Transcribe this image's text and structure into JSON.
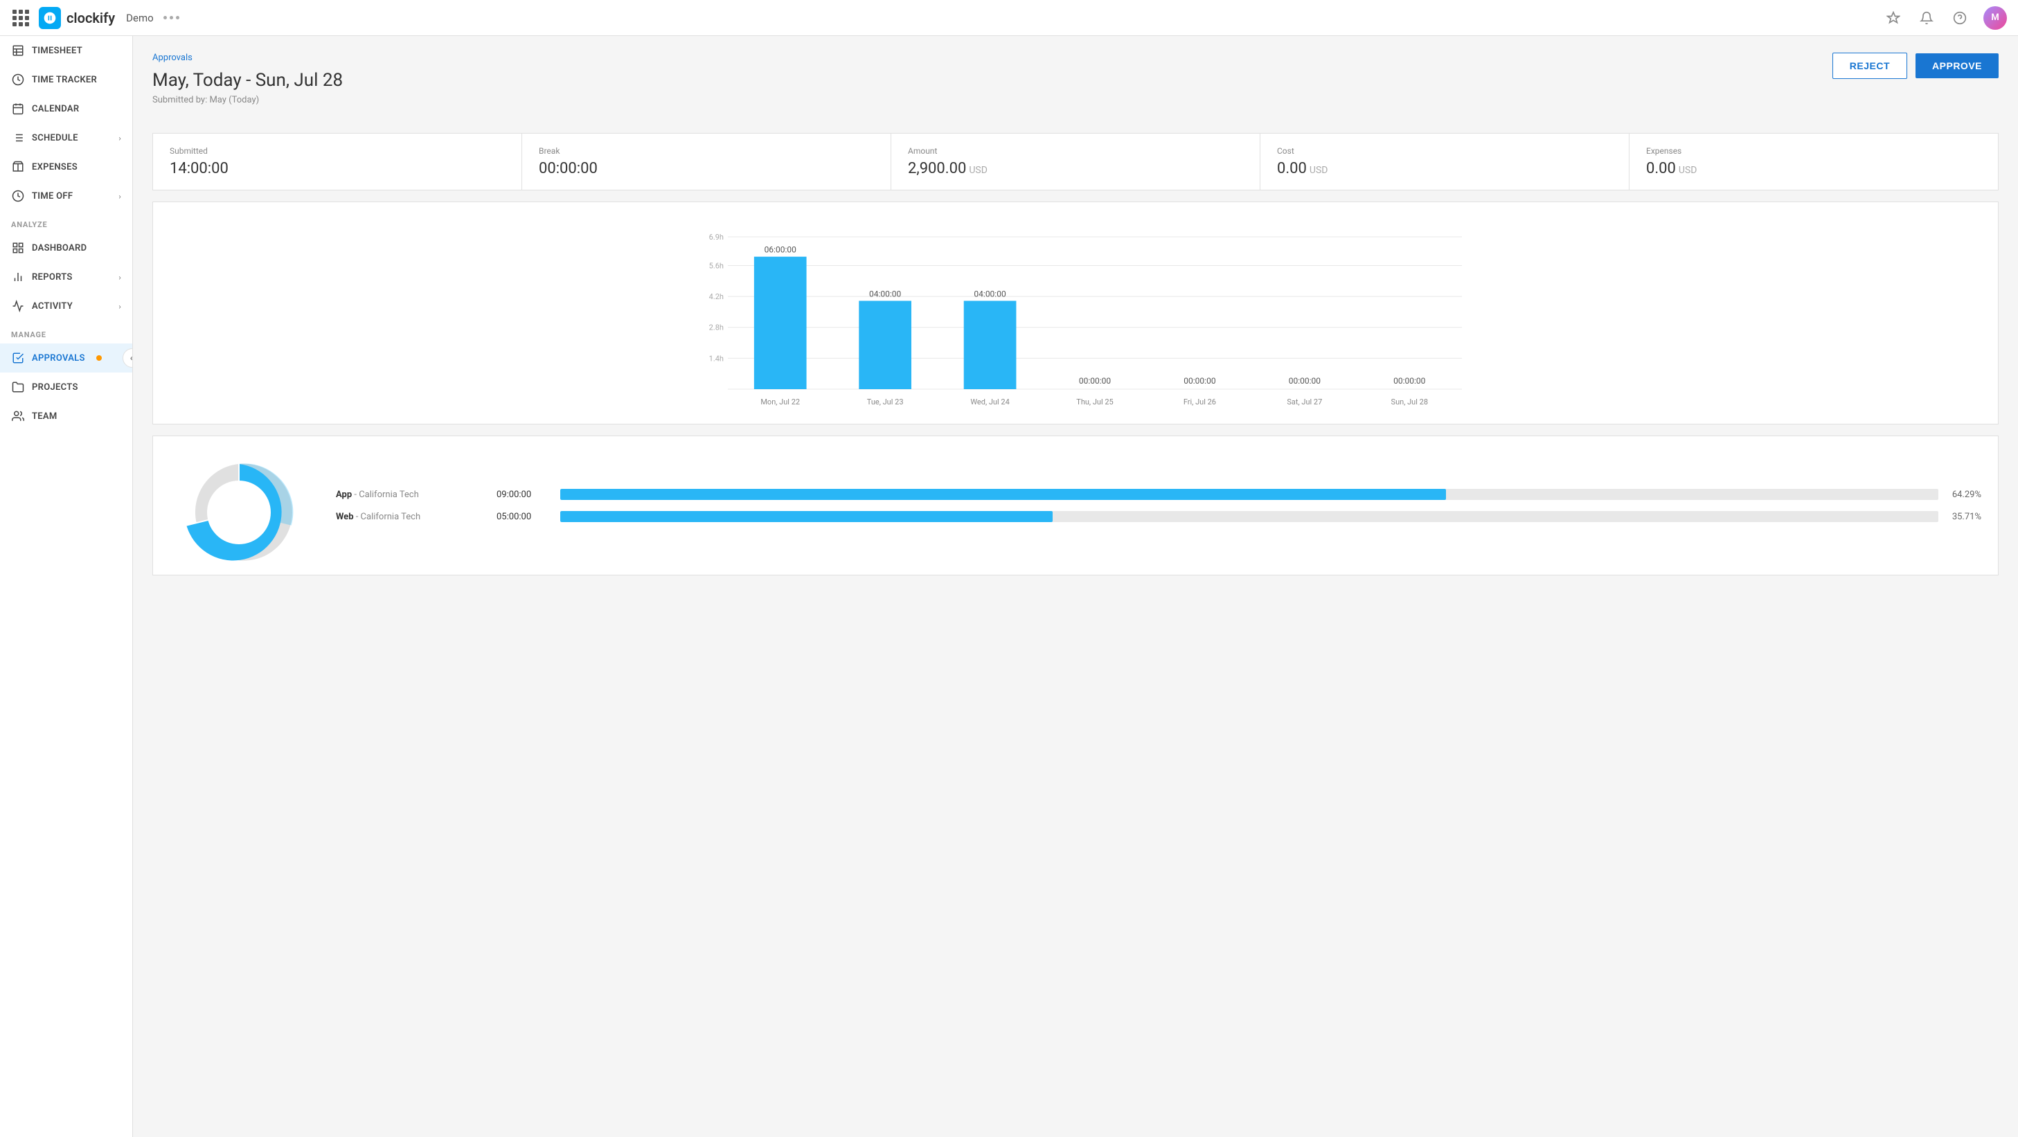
{
  "app": {
    "name": "clockify",
    "workspace": "Demo"
  },
  "topbar": {
    "logo_alt": "Clockify",
    "workspace_label": "Demo",
    "avatar_initials": "M"
  },
  "sidebar": {
    "items": [
      {
        "id": "timesheet",
        "label": "TIMESHEET",
        "icon": "table-icon",
        "active": false,
        "hasChevron": false
      },
      {
        "id": "time-tracker",
        "label": "TIME TRACKER",
        "icon": "clock-icon",
        "active": false,
        "hasChevron": false
      },
      {
        "id": "calendar",
        "label": "CALENDAR",
        "icon": "calendar-icon",
        "active": false,
        "hasChevron": false
      },
      {
        "id": "schedule",
        "label": "SCHEDULE",
        "icon": "schedule-icon",
        "active": false,
        "hasChevron": true
      },
      {
        "id": "expenses",
        "label": "EXPENSES",
        "icon": "receipt-icon",
        "active": false,
        "hasChevron": false
      }
    ],
    "time_off_item": {
      "id": "time-off",
      "label": "TIME OFF",
      "icon": "timeoff-icon",
      "active": false,
      "hasChevron": true
    },
    "analyze_label": "ANALYZE",
    "analyze_items": [
      {
        "id": "dashboard",
        "label": "DASHBOARD",
        "icon": "dashboard-icon",
        "active": false,
        "hasChevron": false
      },
      {
        "id": "reports",
        "label": "REPORTS",
        "icon": "reports-icon",
        "active": false,
        "hasChevron": true
      },
      {
        "id": "activity",
        "label": "ACTIVITY",
        "icon": "activity-icon",
        "active": false,
        "hasChevron": true
      }
    ],
    "manage_label": "MANAGE",
    "manage_items": [
      {
        "id": "approvals",
        "label": "APPROVALS",
        "icon": "approvals-icon",
        "active": true,
        "hasChevron": false,
        "hasBadge": true
      },
      {
        "id": "projects",
        "label": "PROJECTS",
        "icon": "projects-icon",
        "active": false,
        "hasChevron": false
      },
      {
        "id": "team",
        "label": "TEAM",
        "icon": "team-icon",
        "active": false,
        "hasChevron": false
      }
    ]
  },
  "page": {
    "breadcrumb": "Approvals",
    "title": "May, Today - Sun, Jul 28",
    "subtitle": "Submitted by: May (Today)",
    "reject_label": "REJECT",
    "approve_label": "APPROVE"
  },
  "stats": {
    "submitted_label": "Submitted",
    "submitted_value": "14:00:00",
    "break_label": "Break",
    "break_value": "00:00:00",
    "amount_label": "Amount",
    "amount_value": "2,900.00",
    "amount_unit": "USD",
    "cost_label": "Cost",
    "cost_value": "0.00",
    "cost_unit": "USD",
    "expenses_label": "Expenses",
    "expenses_value": "0.00",
    "expenses_unit": "USD"
  },
  "chart": {
    "y_labels": [
      "6.9h",
      "5.6h",
      "4.2h",
      "2.8h",
      "1.4h"
    ],
    "max_h": 6.9,
    "bars": [
      {
        "day": "Mon, Jul 22",
        "value": "06:00:00",
        "hours": 6.0
      },
      {
        "day": "Tue, Jul 23",
        "value": "04:00:00",
        "hours": 4.0
      },
      {
        "day": "Wed, Jul 24",
        "value": "04:00:00",
        "hours": 4.0
      },
      {
        "day": "Thu, Jul 25",
        "value": "00:00:00",
        "hours": 0
      },
      {
        "day": "Fri, Jul 26",
        "value": "00:00:00",
        "hours": 0
      },
      {
        "day": "Sat, Jul 27",
        "value": "00:00:00",
        "hours": 0
      },
      {
        "day": "Sun, Jul 28",
        "value": "00:00:00",
        "hours": 0
      }
    ]
  },
  "legend": {
    "items": [
      {
        "type": "App",
        "project": "California Tech",
        "time": "09:00:00",
        "pct": "64.29%",
        "pct_num": 64.29
      },
      {
        "type": "Web",
        "project": "California Tech",
        "time": "05:00:00",
        "pct": "35.71%",
        "pct_num": 35.71
      }
    ]
  },
  "colors": {
    "accent": "#1976d2",
    "bar": "#29B6F6",
    "approve_bg": "#1976d2",
    "badge": "#FF9800"
  }
}
